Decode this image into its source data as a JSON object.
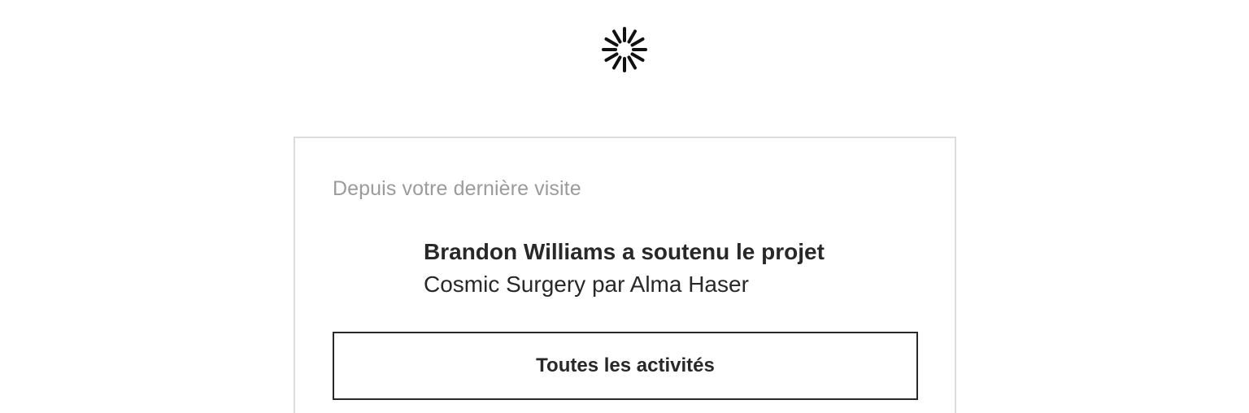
{
  "loader": {
    "icon": "spinner-icon",
    "color": "#111111"
  },
  "card": {
    "section_label": "Depuis votre dernière visite",
    "activity": {
      "title": "Brandon Williams a soutenu le projet",
      "subtitle": "Cosmic Surgery par Alma Haser"
    },
    "all_activity_button": "Toutes les activités"
  }
}
